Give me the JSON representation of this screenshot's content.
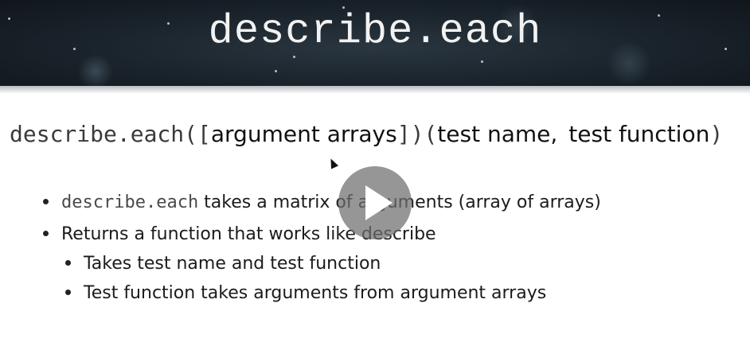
{
  "slide": {
    "title": "describe.each",
    "signature": {
      "prefix": "describe.each([",
      "args": "argument arrays",
      "middle": "])(",
      "test_name": "test name,",
      "test_function": "test function",
      "suffix": ")"
    },
    "bullets": [
      {
        "code": "describe.each",
        "text": " takes a matrix of arguments (array of arrays)"
      },
      {
        "text": "Returns a function that works like describe"
      },
      {
        "text": "Takes test name and test function"
      },
      {
        "text": "Test function takes arguments from argument arrays"
      }
    ]
  },
  "video": {
    "play_icon": "play-icon"
  },
  "colors": {
    "header_background": "#1a232b",
    "title_text": "#f2f2f2",
    "body_text": "#1b1b1b"
  }
}
